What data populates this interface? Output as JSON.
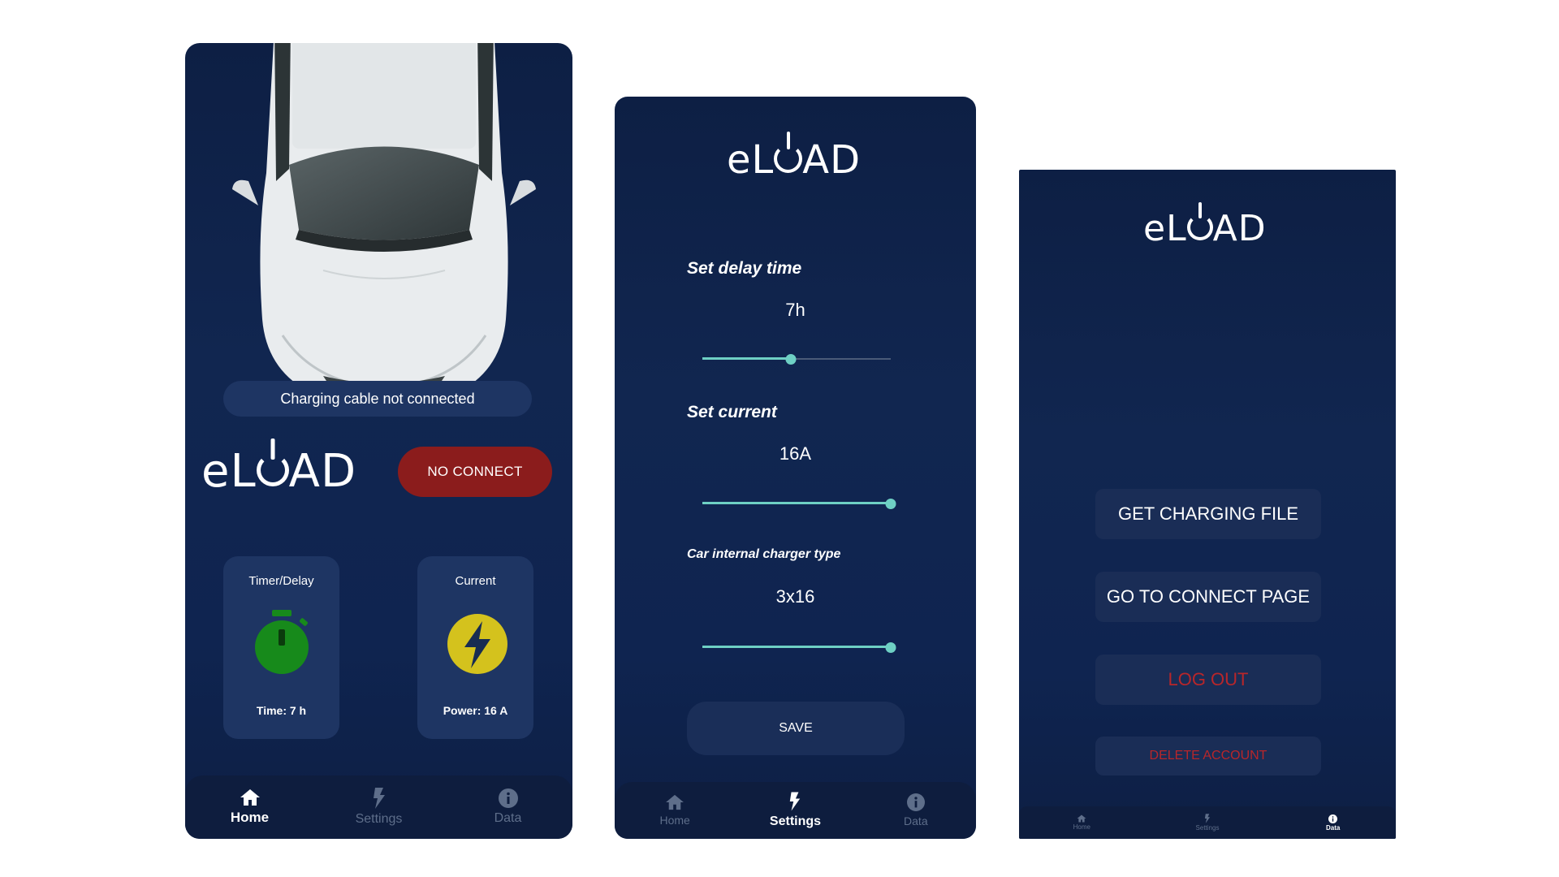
{
  "colors": {
    "background": "#0f2450",
    "card": "#1e3563",
    "accent_teal": "#6ed0c4",
    "danger_red": "#8b1c1c",
    "timer_green": "#178a1b",
    "bolt_yellow": "#d4c21d"
  },
  "brand": {
    "logo_prefix": "eL",
    "logo_suffix": "AD"
  },
  "home": {
    "status_text": "Charging cable not connected",
    "connect_button": "NO CONNECT",
    "timer_card": {
      "title": "Timer/Delay",
      "value": "Time: 7 h",
      "icon": "stopwatch-icon"
    },
    "current_card": {
      "title": "Current",
      "value": "Power: 16 A",
      "icon": "lightning-icon"
    }
  },
  "nav": {
    "items": [
      {
        "label": "Home",
        "icon": "home-icon"
      },
      {
        "label": "Settings",
        "icon": "lightning-icon"
      },
      {
        "label": "Data",
        "icon": "info-icon"
      }
    ]
  },
  "settings": {
    "delay": {
      "label": "Set delay time",
      "value": "7h",
      "fraction": 0.47
    },
    "current": {
      "label": "Set current",
      "value": "16A",
      "fraction": 1.0
    },
    "charger_type": {
      "label": "Car internal charger type",
      "value": "3x16",
      "fraction": 1.0
    },
    "save_button": "SAVE"
  },
  "data_page": {
    "buttons": [
      "GET CHARGING FILE",
      "GO TO CONNECT PAGE",
      "LOG OUT",
      "DELETE ACCOUNT"
    ]
  }
}
